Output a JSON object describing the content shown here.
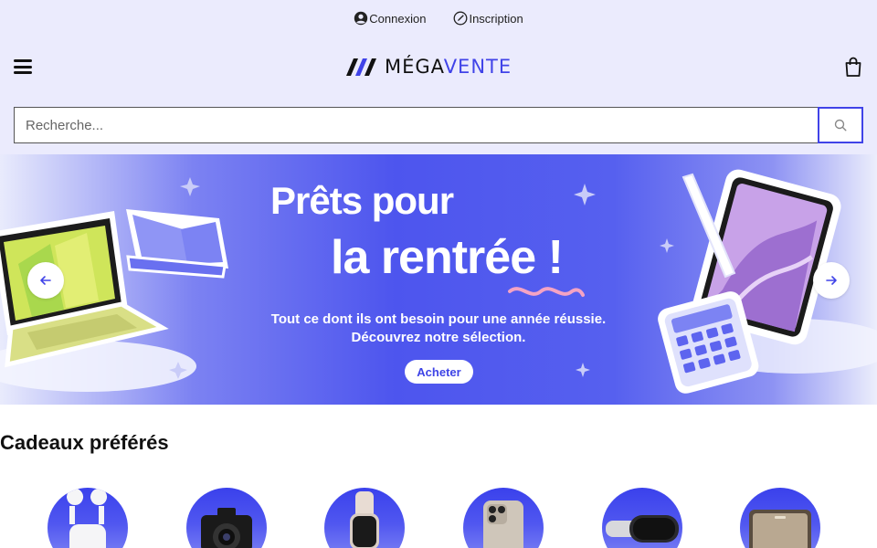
{
  "account": {
    "login_label": "Connexion",
    "signup_label": "Inscription"
  },
  "header": {
    "logo_part1": "MÉGA",
    "logo_part2": "VENTE"
  },
  "search": {
    "placeholder": "Recherche..."
  },
  "banner": {
    "title_line1": "Prêts pour",
    "title_line2": "la rentrée !",
    "subtitle_line1": "Tout ce dont ils ont besoin pour une année réussie.",
    "subtitle_line2": "Découvrez notre sélection.",
    "cta_label": "Acheter"
  },
  "favorites": {
    "title": "Cadeaux préférés",
    "items": [
      {
        "icon": "earbuds-icon"
      },
      {
        "icon": "camera-icon"
      },
      {
        "icon": "smartwatch-icon"
      },
      {
        "icon": "smartphone-icon"
      },
      {
        "icon": "vr-headset-icon"
      },
      {
        "icon": "speaker-icon"
      }
    ]
  },
  "colors": {
    "brand": "#4043e8",
    "top_background": "#ebebfd"
  }
}
